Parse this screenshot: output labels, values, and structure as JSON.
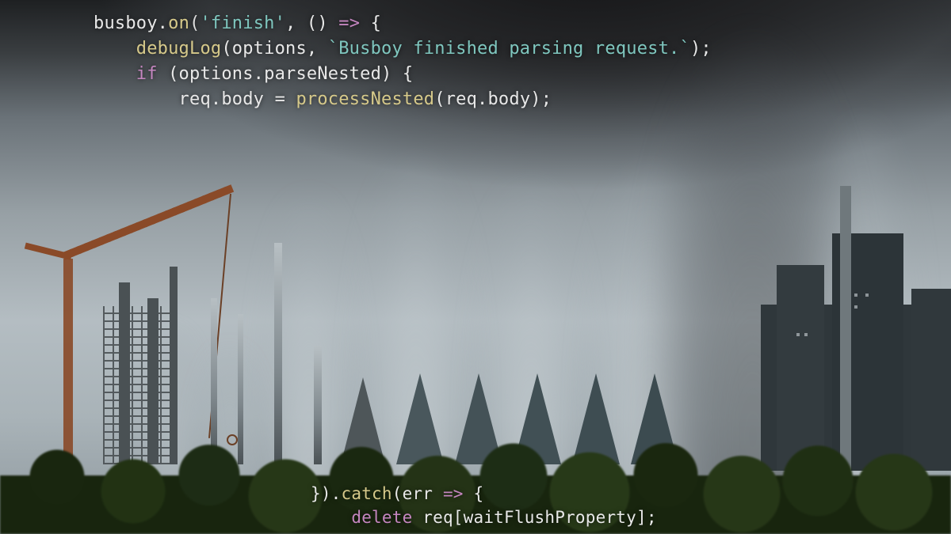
{
  "code_top": {
    "l1_a": "busboy.",
    "l1_b": "on",
    "l1_c": "(",
    "l1_d": "'finish'",
    "l1_e": ", () ",
    "l1_f": "=>",
    "l1_g": " {",
    "l2_a": "    ",
    "l2_b": "debugLog",
    "l2_c": "(options, ",
    "l2_d": "`Busboy finished parsing request.`",
    "l2_e": ");",
    "l3_a": "    ",
    "l3_b": "if",
    "l3_c": " (options.parseNested) {",
    "l4_a": "        req.body = ",
    "l4_b": "processNested",
    "l4_c": "(req.body);"
  },
  "code_bottom": {
    "l1_a": "}).",
    "l1_b": "catch",
    "l1_c": "(err ",
    "l1_d": "=>",
    "l1_e": " {",
    "l2_a": "    ",
    "l2_b": "delete",
    "l2_c": " req[waitFlushProperty];"
  }
}
